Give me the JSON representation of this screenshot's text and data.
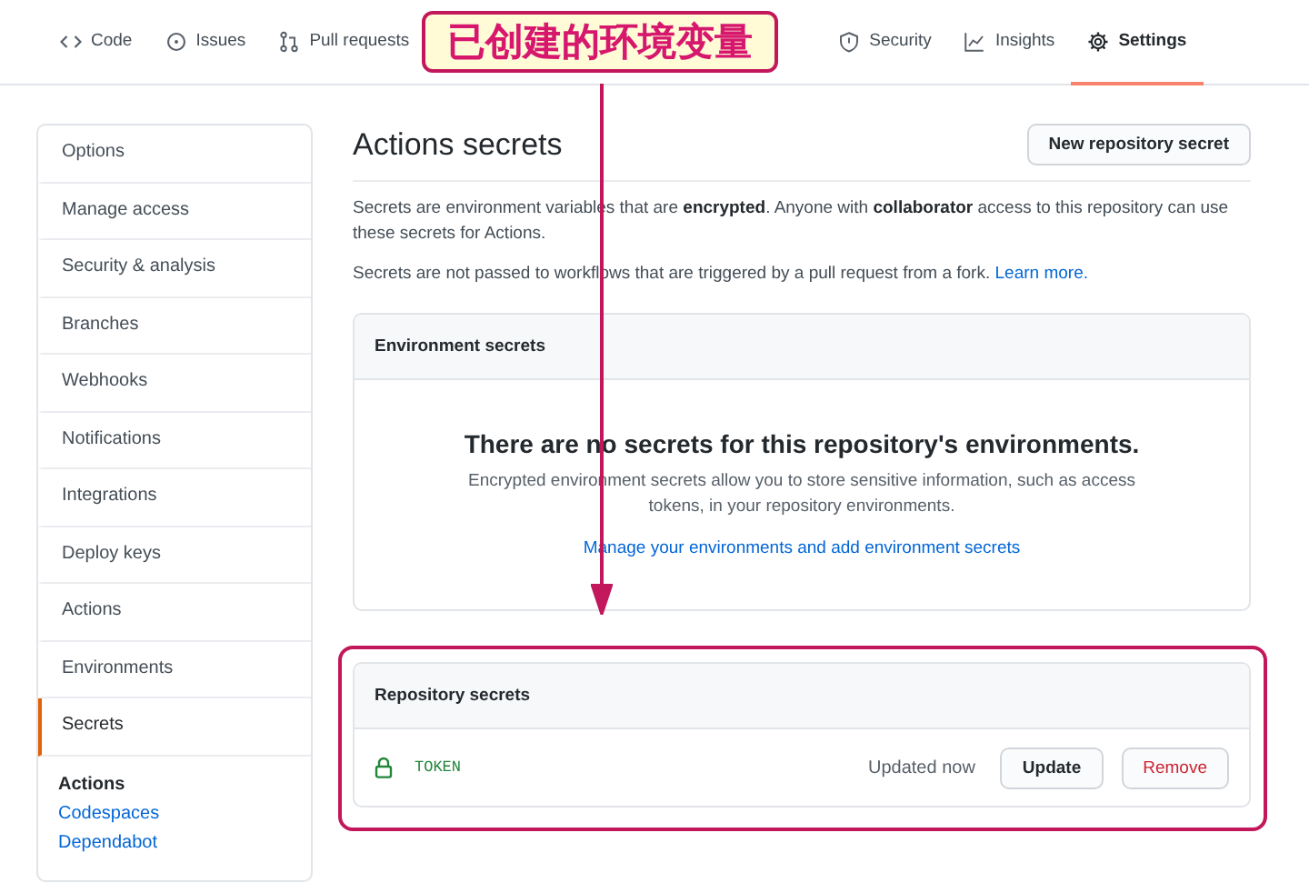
{
  "tabs": [
    {
      "label": "Code",
      "selected": false
    },
    {
      "label": "Issues",
      "selected": false
    },
    {
      "label": "Pull requests",
      "selected": false
    },
    {
      "label": "Security",
      "selected": false
    },
    {
      "label": "Insights",
      "selected": false
    },
    {
      "label": "Settings",
      "selected": true
    }
  ],
  "annotation": {
    "callout": "已创建的环境变量"
  },
  "sidebar": {
    "items": [
      {
        "label": "Options",
        "selected": false
      },
      {
        "label": "Manage access",
        "selected": false
      },
      {
        "label": "Security & analysis",
        "selected": false
      },
      {
        "label": "Branches",
        "selected": false
      },
      {
        "label": "Webhooks",
        "selected": false
      },
      {
        "label": "Notifications",
        "selected": false
      },
      {
        "label": "Integrations",
        "selected": false
      },
      {
        "label": "Deploy keys",
        "selected": false
      },
      {
        "label": "Actions",
        "selected": false
      },
      {
        "label": "Environments",
        "selected": false
      },
      {
        "label": "Secrets",
        "selected": true
      }
    ],
    "section": {
      "title": "Actions",
      "links": [
        "Codespaces",
        "Dependabot"
      ]
    }
  },
  "main": {
    "title": "Actions secrets",
    "new_button": "New repository secret",
    "intro": "Secrets are environment variables that are **encrypted**. Anyone with **collaborator** access to this repository can use these secrets for Actions.",
    "note": {
      "text": "Secrets are not passed to workflows that are triggered by a pull request from a fork.",
      "link": "Learn more."
    },
    "environment_secrets": {
      "title": "Environment secrets",
      "empty_title": "There are no secrets for this repository's environments.",
      "empty_text": "Encrypted environment secrets allow you to store sensitive information, such as access tokens, in your repository environments.",
      "link": "Manage your environments and add environment secrets"
    },
    "repository_secrets": {
      "title": "Repository secrets",
      "rows": [
        {
          "name": "TOKEN",
          "updated": "Updated now",
          "update_button": "Update",
          "remove_button": "Remove"
        }
      ]
    }
  }
}
